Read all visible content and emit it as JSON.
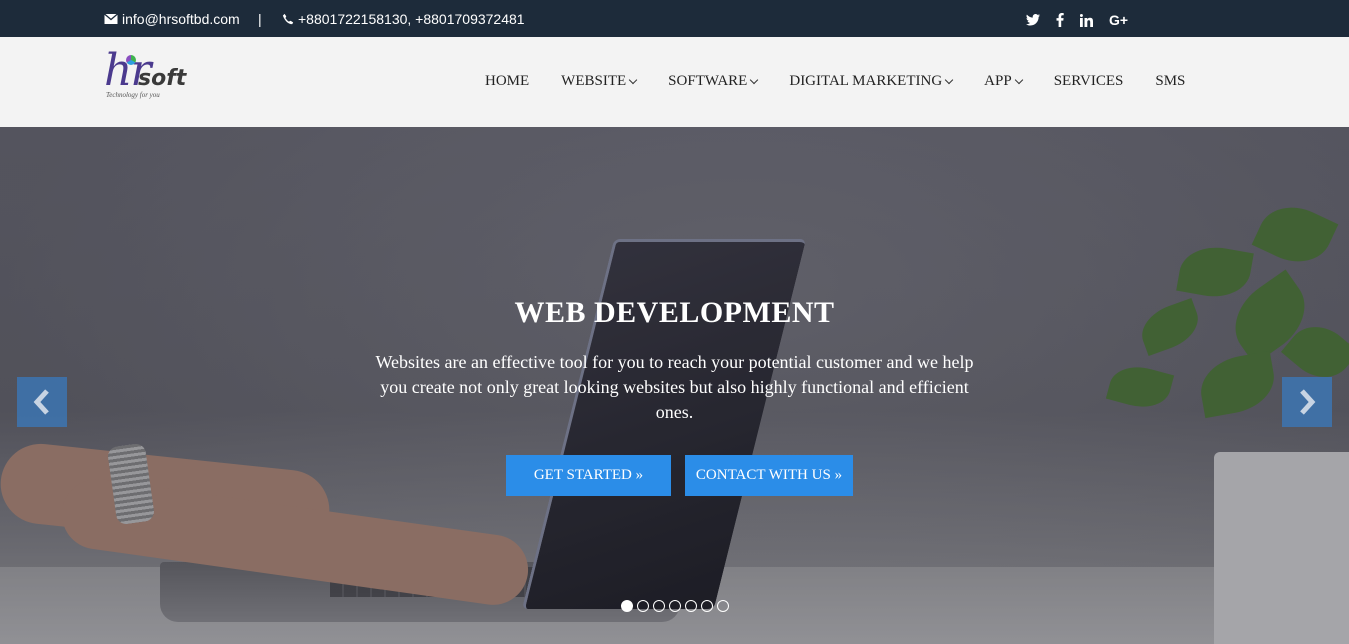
{
  "topbar": {
    "email": "info@hrsoftbd.com",
    "separator": "|",
    "phone": "+8801722158130, +8801709372481",
    "social": [
      "twitter-icon",
      "facebook-icon",
      "linkedin-icon",
      "google-plus-icon"
    ]
  },
  "logo": {
    "main": "hr",
    "soft": "soft",
    "tagline": "Technology for you"
  },
  "nav": {
    "items": [
      {
        "label": "HOME",
        "dropdown": false
      },
      {
        "label": "WEBSITE",
        "dropdown": true
      },
      {
        "label": "SOFTWARE",
        "dropdown": true
      },
      {
        "label": "DIGITAL MARKETING",
        "dropdown": true
      },
      {
        "label": "APP",
        "dropdown": true
      },
      {
        "label": "SERVICES",
        "dropdown": false
      },
      {
        "label": "SMS",
        "dropdown": false
      }
    ]
  },
  "hero": {
    "title": "WEB DEVELOPMENT",
    "text": "Websites are an effective tool for you to reach your potential customer and we help you create not only great looking websites but also highly functional and efficient ones.",
    "primary_button": "GET STARTED »",
    "secondary_button": "CONTACT WITH US »",
    "slide_count": 7,
    "active_slide": 1
  },
  "colors": {
    "topbar_bg": "#1d2b3a",
    "header_bg": "#f3f3f3",
    "button_bg": "#2b8de8"
  }
}
